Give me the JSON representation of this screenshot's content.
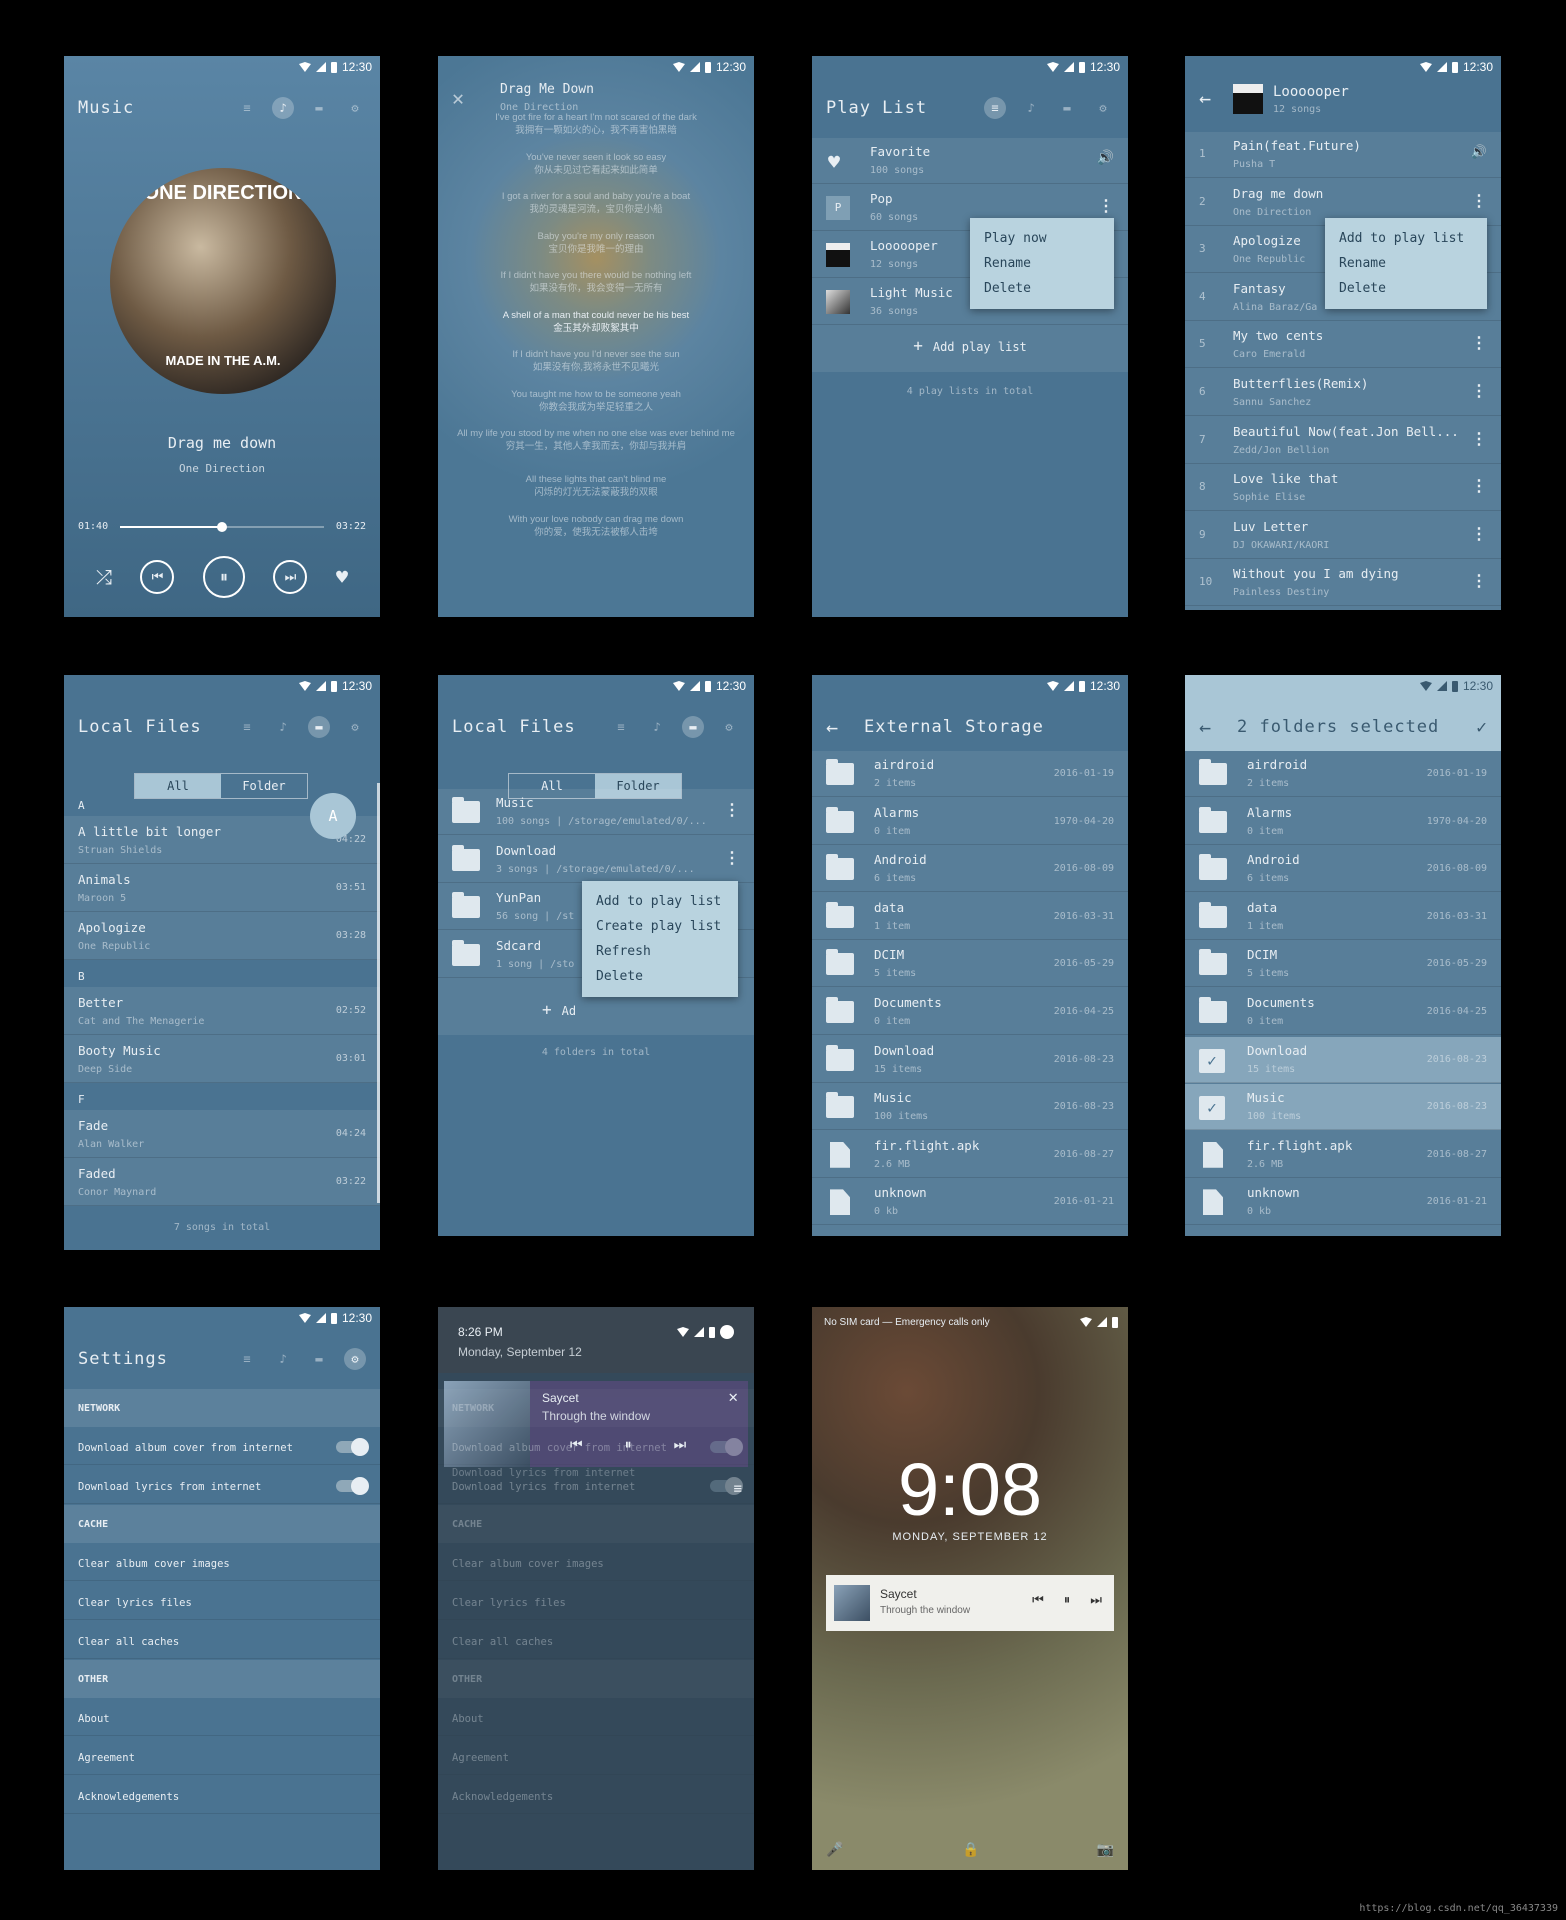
{
  "status_time": "12:30",
  "icons": {
    "playlist": "≡",
    "note": "♪",
    "folder": "▬",
    "settings": "⚙"
  },
  "player": {
    "title": "Music",
    "album_text": "ONE DIRECTION",
    "album_sub": "MADE IN THE A.M.",
    "song": "Drag me down",
    "artist": "One Direction",
    "elapsed": "01:40",
    "total": "03:22",
    "progress": 0.5
  },
  "lyrics": {
    "song": "Drag Me Down",
    "artist": "One Direction",
    "lines": [
      [
        "I've got fire for a heart I'm not scared of the dark",
        "我拥有一颗如火的心，我不再害怕黑暗"
      ],
      [
        "You've never seen it look so easy",
        "你从未见过它看起来如此简单"
      ],
      [
        "I got a river for a soul and baby you're a boat",
        "我的灵魂是河流，宝贝你是小船"
      ],
      [
        "Baby you're my only reason",
        "宝贝你是我唯一的理由"
      ],
      [
        "If I didn't have you there would be nothing left",
        "如果没有你，我会变得一无所有"
      ],
      [
        "A shell of a man that could never be his best",
        "金玉其外却败絮其中"
      ],
      [
        "If I didn't have you I'd never see the sun",
        "如果没有你,我将永世不见曦光"
      ],
      [
        "You taught me how to be someone yeah",
        "你教会我成为举足轻重之人"
      ],
      [
        "All my life you stood by me when no one else was ever behind me",
        "穷其一生，其他人拿我而去，你却与我并肩"
      ],
      [
        "All these lights that can't blind me",
        "闪烁的灯光无法蒙蔽我的双眼"
      ],
      [
        "With your love nobody can drag me down",
        "你的爱，使我无法被郁人击垮"
      ]
    ]
  },
  "playlists": {
    "title": "Play List",
    "items": [
      {
        "name": "Favorite",
        "sub": "100 songs"
      },
      {
        "name": "Pop",
        "sub": "60 songs"
      },
      {
        "name": "Loooooper",
        "sub": "12 songs"
      },
      {
        "name": "Light Music",
        "sub": "36 songs"
      }
    ],
    "add": "Add play list",
    "footer": "4 play lists in total",
    "menu": [
      "Play now",
      "Rename",
      "Delete"
    ]
  },
  "looper": {
    "title": "Loooooper",
    "sub": "12 songs",
    "songs": [
      {
        "n": "1",
        "name": "Pain(feat.Future)",
        "artist": "Pusha T"
      },
      {
        "n": "2",
        "name": "Drag me down",
        "artist": "One Direction"
      },
      {
        "n": "3",
        "name": "Apologize",
        "artist": "One Republic"
      },
      {
        "n": "4",
        "name": "Fantasy",
        "artist": "Alina Baraz/Ga"
      },
      {
        "n": "5",
        "name": "My two cents",
        "artist": "Caro Emerald"
      },
      {
        "n": "6",
        "name": "Butterflies(Remix)",
        "artist": "Sannu Sanchez"
      },
      {
        "n": "7",
        "name": "Beautiful Now(feat.Jon Bell...",
        "artist": "Zedd/Jon Bellion"
      },
      {
        "n": "8",
        "name": "Love like that",
        "artist": "Sophie Elise"
      },
      {
        "n": "9",
        "name": "Luv Letter",
        "artist": "DJ OKAWARI/KAORI"
      },
      {
        "n": "10",
        "name": "Without you I am dying",
        "artist": "Painless Destiny"
      }
    ],
    "menu": [
      "Add to play list",
      "Rename",
      "Delete"
    ]
  },
  "local": {
    "title": "Local Files",
    "tab_all": "All",
    "tab_folder": "Folder",
    "index": "A",
    "rows": [
      {
        "h": "A"
      },
      {
        "name": "A little bit longer",
        "artist": "Struan Shields",
        "dur": "04:22"
      },
      {
        "name": "Animals",
        "artist": "Maroon 5",
        "dur": "03:51"
      },
      {
        "name": "Apologize",
        "artist": "One Republic",
        "dur": "03:28"
      },
      {
        "h": "B"
      },
      {
        "name": "Better",
        "artist": "Cat and The Menagerie",
        "dur": "02:52"
      },
      {
        "name": "Booty Music",
        "artist": "Deep Side",
        "dur": "03:01"
      },
      {
        "h": "F"
      },
      {
        "name": "Fade",
        "artist": "Alan Walker",
        "dur": "04:24"
      },
      {
        "name": "Faded",
        "artist": "Conor Maynard",
        "dur": "03:22"
      }
    ],
    "footer": "7 songs in total"
  },
  "folders": {
    "items": [
      {
        "name": "Music",
        "sub": "100 songs | /storage/emulated/0/..."
      },
      {
        "name": "Download",
        "sub": "3 songs | /storage/emulated/0/..."
      },
      {
        "name": "YunPan",
        "sub": "56 song | /st"
      },
      {
        "name": "Sdcard",
        "sub": "1 song | /sto"
      }
    ],
    "add": "Ad",
    "footer": "4 folders in total",
    "menu": [
      "Add to play list",
      "Create play list",
      "Refresh",
      "Delete"
    ]
  },
  "storage": {
    "title": "External Storage",
    "sel_title": "2 folders selected",
    "items": [
      {
        "name": "airdroid",
        "sub": "2 items",
        "date": "2016-01-19",
        "type": "folder"
      },
      {
        "name": "Alarms",
        "sub": "0 item",
        "date": "1970-04-20",
        "type": "folder"
      },
      {
        "name": "Android",
        "sub": "6 items",
        "date": "2016-08-09",
        "type": "folder"
      },
      {
        "name": "data",
        "sub": "1 item",
        "date": "2016-03-31",
        "type": "folder"
      },
      {
        "name": "DCIM",
        "sub": "5 items",
        "date": "2016-05-29",
        "type": "folder"
      },
      {
        "name": "Documents",
        "sub": "0 item",
        "date": "2016-04-25",
        "type": "folder"
      },
      {
        "name": "Download",
        "sub": "15 items",
        "date": "2016-08-23",
        "type": "folder"
      },
      {
        "name": "Music",
        "sub": "100 items",
        "date": "2016-08-23",
        "type": "folder"
      },
      {
        "name": "fir.flight.apk",
        "sub": "2.6 MB",
        "date": "2016-08-27",
        "type": "file"
      },
      {
        "name": "unknown",
        "sub": "0 kb",
        "date": "2016-01-21",
        "type": "file"
      }
    ]
  },
  "settings": {
    "title": "Settings",
    "sections": [
      {
        "h": "NETWORK",
        "items": [
          {
            "t": "Download album cover from internet",
            "toggle": true
          },
          {
            "t": "Download lyrics from internet",
            "toggle": true
          }
        ]
      },
      {
        "h": "CACHE",
        "items": [
          {
            "t": "Clear album cover images"
          },
          {
            "t": "Clear lyrics files"
          },
          {
            "t": "Clear all caches"
          }
        ]
      },
      {
        "h": "OTHER",
        "items": [
          {
            "t": "About"
          },
          {
            "t": "Agreement"
          },
          {
            "t": "Acknowledgements"
          }
        ]
      }
    ]
  },
  "notif": {
    "time": "8:26 PM",
    "date": "Monday, September 12",
    "artist": "Saycet",
    "song": "Through the window",
    "peek": "Download lyrics from internet"
  },
  "lock": {
    "carrier": "No SIM card — Emergency calls only",
    "clock": "9:08",
    "date": "MONDAY, SEPTEMBER 12",
    "artist": "Saycet",
    "song": "Through the window"
  },
  "watermark": "https://blog.csdn.net/qq_36437339"
}
